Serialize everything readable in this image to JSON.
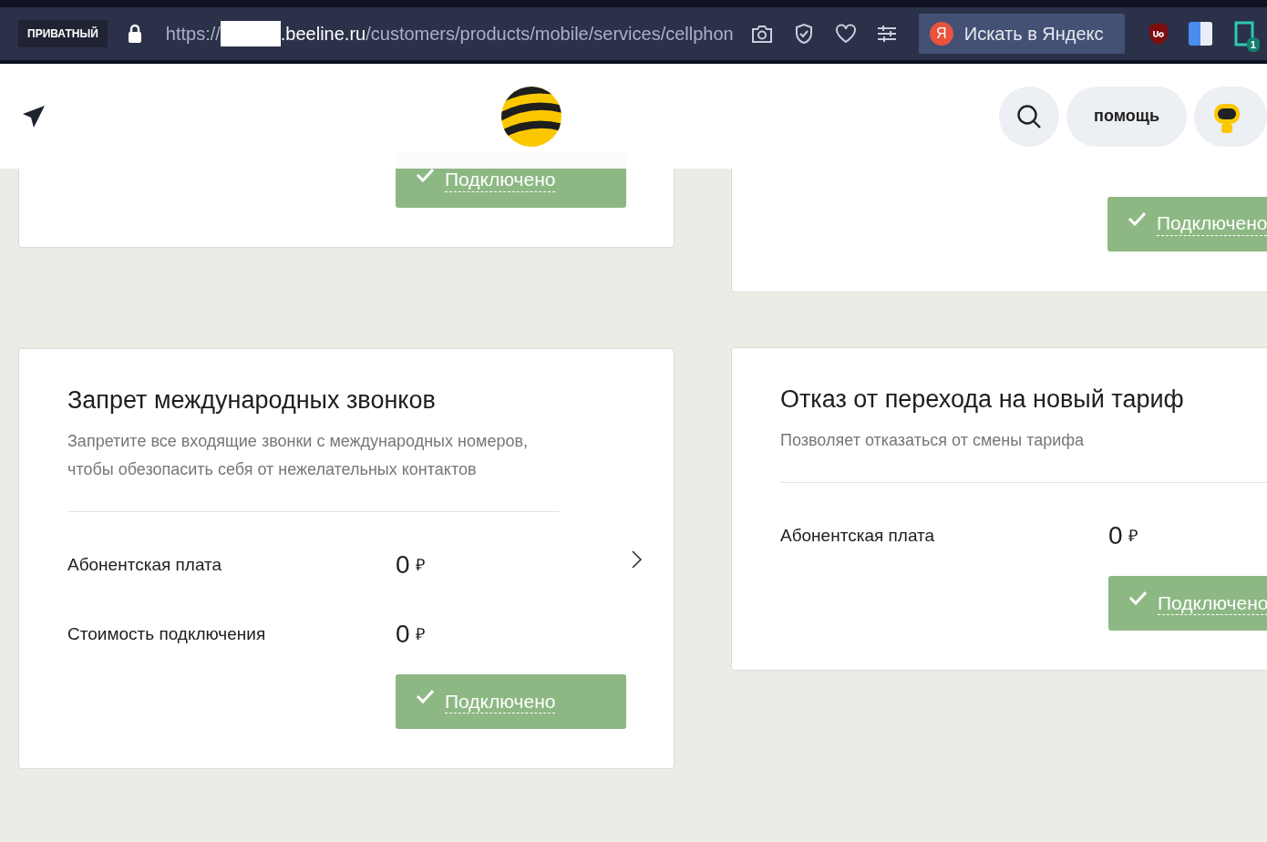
{
  "browser": {
    "badge": "ПРИВАТНЫЙ",
    "url_scheme": "https://",
    "url_host": ".beeline.ru",
    "url_path": "/customers/products/mobile/services/cellphon",
    "search_logo": "Я",
    "search_button": "Искать в Яндекс",
    "extension_badge": "1"
  },
  "header": {
    "help_button": "помощь"
  },
  "columns": [
    {
      "cards": [
        {
          "status_button": {
            "label": "Подключено",
            "connected": true
          }
        },
        {
          "title": "Запрет международных звонков",
          "description": "Запретите все входящие звонки с международных номеров, чтобы обезопасить себя от нежелательных контактов",
          "rows": [
            {
              "label": "Абонентская плата",
              "amount": "0",
              "currency": "₽",
              "chevron": true
            },
            {
              "label": "Стоимость подключения",
              "amount": "0",
              "currency": "₽",
              "chevron": false
            }
          ],
          "status_button": {
            "label": "Подключено",
            "connected": true
          }
        }
      ]
    },
    {
      "cards": [
        {
          "status_button": {
            "label": "Подключено",
            "connected": true
          }
        },
        {
          "title": "Отказ от перехода на новый тариф",
          "description": "Позволяет отказаться от смены тарифа",
          "rows": [
            {
              "label": "Абонентская плата",
              "amount": "0",
              "currency": "₽"
            }
          ],
          "status_button": {
            "label": "Подключено",
            "connected": true
          }
        }
      ]
    }
  ]
}
